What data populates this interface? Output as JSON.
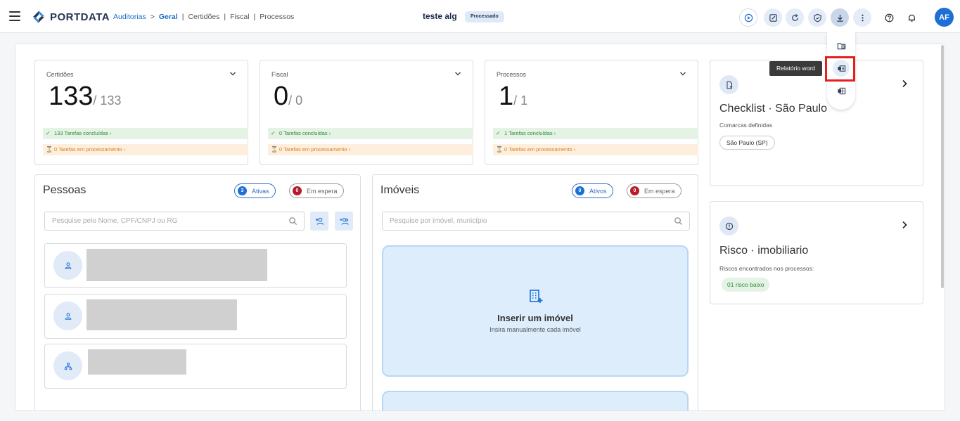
{
  "header": {
    "logo_text": "PORTDATA",
    "breadcrumb": {
      "root": "Auditorias",
      "separator": ">",
      "active": "Geral",
      "links": [
        "Certidões",
        "Fiscal",
        "Processos"
      ]
    },
    "title": "teste alg",
    "status_badge": "Processado",
    "toolbar_icons": [
      "play-icon",
      "edit-icon",
      "refresh-icon",
      "shield-check-icon",
      "download-icon",
      "more-vertical-icon",
      "help-icon",
      "bell-icon"
    ],
    "avatar_initials": "AF"
  },
  "download_menu": {
    "items": [
      "folder-icon",
      "word-report-icon",
      "excel-report-icon"
    ],
    "tooltip": "Relatório word"
  },
  "summary_cards": [
    {
      "label": "Certidões",
      "value": "133",
      "total": "/ 133",
      "done": "133 Tarefas concluídas",
      "processing": "0 Tarefas em processamento"
    },
    {
      "label": "Fiscal",
      "value": "0",
      "total": "/ 0",
      "done": "0 Tarefas concluídas",
      "processing": "0 Tarefas em processamento"
    },
    {
      "label": "Processos",
      "value": "1",
      "total": "/ 1",
      "done": "1 Tarefas concluídas",
      "processing": "0 Tarefas em processamento"
    }
  ],
  "pessoas": {
    "title": "Pessoas",
    "active_count": "3",
    "active_label": "Ativas",
    "waiting_count": "0",
    "waiting_label": "Em espera",
    "search_placeholder": "Pesquise pelo Nome, CPF/CNPJ ou RG",
    "items": [
      {
        "icon": "person-icon"
      },
      {
        "icon": "person-icon"
      },
      {
        "icon": "company-icon"
      }
    ]
  },
  "imoveis": {
    "title": "Imóveis",
    "active_count": "0",
    "active_label": "Ativos",
    "waiting_count": "0",
    "waiting_label": "Em espera",
    "search_placeholder": "Pesquise por imóvel, município",
    "insert_title": "Inserir um imóvel",
    "insert_subtitle": "Insira manualmente cada imóvel"
  },
  "checklist": {
    "title": "Checklist · São Paulo",
    "subtitle": "Comarcas definidas",
    "chip": "São Paulo (SP)"
  },
  "risco": {
    "title": "Risco · imobiliario",
    "subtitle": "Riscos encontrados nos processos:",
    "chip": "01 risco baixo"
  },
  "colors": {
    "accent": "#1d6fd6",
    "brand": "#253553",
    "highlight": "#e51e1e"
  }
}
